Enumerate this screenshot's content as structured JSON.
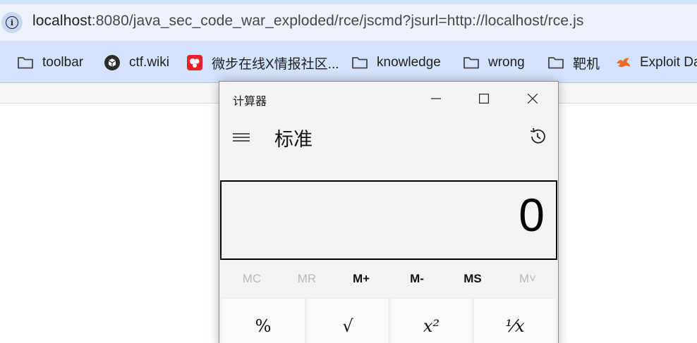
{
  "browser": {
    "url_host": "localhost",
    "url_rest": ":8080/java_sec_code_war_exploded/rce/jscmd?jsurl=http://localhost/rce.js"
  },
  "bookmarks": [
    {
      "label": "toolbar",
      "icon": "folder-icon"
    },
    {
      "label": "ctf.wiki",
      "icon": "ctfwiki-icon"
    },
    {
      "label": "微步在线X情报社区...",
      "icon": "threatbook-icon"
    },
    {
      "label": "knowledge",
      "icon": "folder-icon"
    },
    {
      "label": "wrong",
      "icon": "folder-icon"
    },
    {
      "label": "靶机",
      "icon": "folder-icon"
    },
    {
      "label": "Exploit Da",
      "icon": "exploitdb-icon"
    }
  ],
  "calculator": {
    "window_title": "计算器",
    "mode": "标准",
    "display": "0",
    "memory": [
      {
        "label": "MC",
        "enabled": false
      },
      {
        "label": "MR",
        "enabled": false
      },
      {
        "label": "M+",
        "enabled": true
      },
      {
        "label": "M-",
        "enabled": true
      },
      {
        "label": "MS",
        "enabled": true
      },
      {
        "label": "M˅",
        "enabled": false
      }
    ],
    "keys": [
      "%",
      "√",
      "x²",
      "¹⁄x"
    ]
  }
}
